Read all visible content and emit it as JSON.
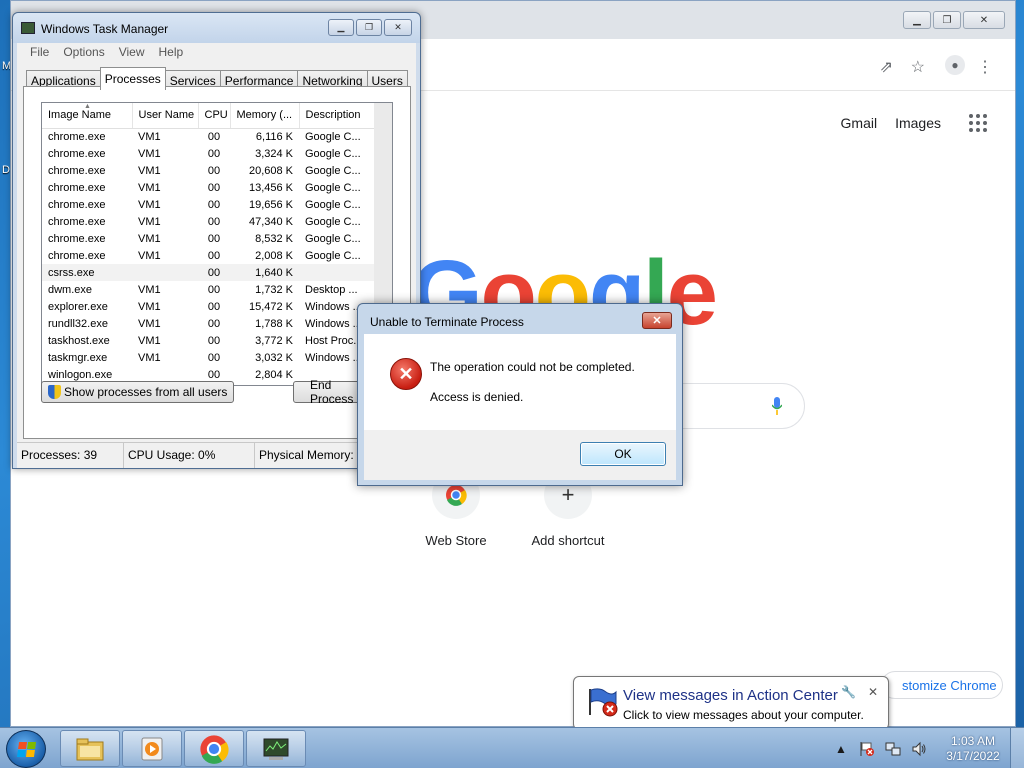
{
  "desktop": {
    "frag_top": "M",
    "frag_mid": "D"
  },
  "chrome": {
    "links": {
      "gmail": "Gmail",
      "images": "Images"
    },
    "google_logo": [
      "G",
      "o",
      "o",
      "g",
      "l",
      "e"
    ],
    "shortcuts": [
      {
        "label": "Web Store",
        "icon": "chrome-webstore-icon"
      },
      {
        "label": "Add shortcut",
        "icon": "plus-icon"
      }
    ],
    "customize_label": "stomize Chrome"
  },
  "task_manager": {
    "title": "Windows Task Manager",
    "menu": [
      "File",
      "Options",
      "View",
      "Help"
    ],
    "tabs": [
      "Applications",
      "Processes",
      "Services",
      "Performance",
      "Networking",
      "Users"
    ],
    "active_tab": "Processes",
    "columns": [
      "Image Name",
      "User Name",
      "CPU",
      "Memory (...",
      "Description"
    ],
    "rows": [
      [
        "chrome.exe",
        "VM1",
        "00",
        "6,116 K",
        "Google C..."
      ],
      [
        "chrome.exe",
        "VM1",
        "00",
        "3,324 K",
        "Google C..."
      ],
      [
        "chrome.exe",
        "VM1",
        "00",
        "20,608 K",
        "Google C..."
      ],
      [
        "chrome.exe",
        "VM1",
        "00",
        "13,456 K",
        "Google C..."
      ],
      [
        "chrome.exe",
        "VM1",
        "00",
        "19,656 K",
        "Google C..."
      ],
      [
        "chrome.exe",
        "VM1",
        "00",
        "47,340 K",
        "Google C..."
      ],
      [
        "chrome.exe",
        "VM1",
        "00",
        "8,532 K",
        "Google C..."
      ],
      [
        "chrome.exe",
        "VM1",
        "00",
        "2,008 K",
        "Google C..."
      ],
      [
        "csrss.exe",
        "",
        "00",
        "1,640 K",
        ""
      ],
      [
        "dwm.exe",
        "VM1",
        "00",
        "1,732 K",
        "Desktop ..."
      ],
      [
        "explorer.exe",
        "VM1",
        "00",
        "15,472 K",
        "Windows ..."
      ],
      [
        "rundll32.exe",
        "VM1",
        "00",
        "1,788 K",
        "Windows ..."
      ],
      [
        "taskhost.exe",
        "VM1",
        "00",
        "3,772 K",
        "Host Proc..."
      ],
      [
        "taskmgr.exe",
        "VM1",
        "00",
        "3,032 K",
        "Windows ..."
      ],
      [
        "winlogon.exe",
        "",
        "00",
        "2,804 K",
        ""
      ]
    ],
    "show_all_label": "Show processes from all users",
    "end_process_label": "End Process",
    "status": {
      "processes": "Processes: 39",
      "cpu": "CPU Usage: 0%",
      "memory": "Physical Memory: 1"
    }
  },
  "dialog": {
    "title": "Unable to Terminate Process",
    "close_glyph": "✕",
    "message": "The operation could not be completed.",
    "detail": "Access is denied.",
    "ok_label": "OK"
  },
  "balloon": {
    "title": "View messages in Action Center",
    "text": "Click to view messages about your computer."
  },
  "taskbar": {
    "pinned": [
      "explorer-icon",
      "media-player-icon",
      "chrome-icon",
      "task-manager-icon"
    ],
    "clock_time": "1:03 AM",
    "clock_date": "3/17/2022"
  },
  "colors": {
    "google_blue": "#4285f4",
    "google_red": "#ea4335",
    "google_yellow": "#fbbc05",
    "google_green": "#34a853"
  }
}
